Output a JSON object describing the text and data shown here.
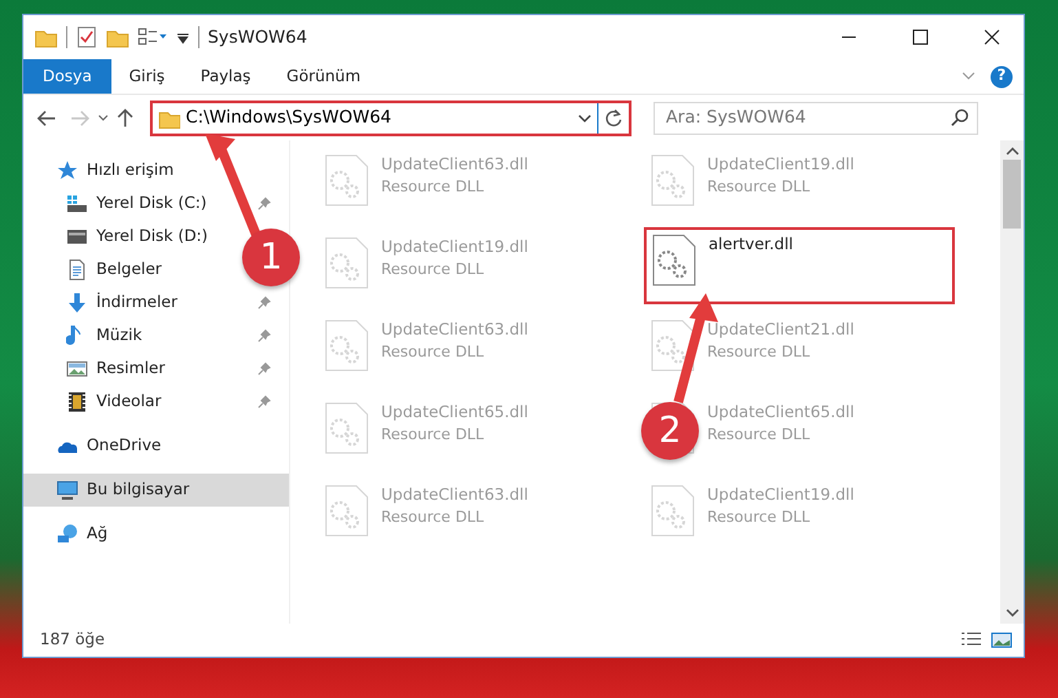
{
  "window": {
    "title": "SysWOW64"
  },
  "ribbon_tabs": [
    {
      "label": "Dosya",
      "selected": true
    },
    {
      "label": "Giriş",
      "selected": false
    },
    {
      "label": "Paylaş",
      "selected": false
    },
    {
      "label": "Görünüm",
      "selected": false
    }
  ],
  "help": "?",
  "navigation": {
    "back_disabled": false,
    "forward_disabled": true
  },
  "address_bar": {
    "path": "C:\\Windows\\SysWOW64",
    "highlighted": true
  },
  "search": {
    "placeholder": "Ara: SysWOW64"
  },
  "sidebar": {
    "items": [
      {
        "label": "Hızlı erişim",
        "kind": "star",
        "selected": false,
        "children": [
          {
            "label": "Yerel Disk (C:)",
            "kind": "drive-c",
            "pinned": true,
            "selected": false
          },
          {
            "label": "Yerel Disk (D:)",
            "kind": "drive",
            "pinned": false,
            "selected": false
          },
          {
            "label": "Belgeler",
            "kind": "document",
            "pinned": false,
            "selected": false
          },
          {
            "label": "İndirmeler",
            "kind": "download",
            "pinned": true,
            "selected": false
          },
          {
            "label": "Müzik",
            "kind": "music",
            "pinned": true,
            "selected": false
          },
          {
            "label": "Resimler",
            "kind": "picture",
            "pinned": true,
            "selected": false
          },
          {
            "label": "Videolar",
            "kind": "video",
            "pinned": true,
            "selected": false
          }
        ]
      },
      {
        "label": "OneDrive",
        "kind": "cloud",
        "selected": false
      },
      {
        "label": "Bu bilgisayar",
        "kind": "computer",
        "selected": true
      },
      {
        "label": "Ağ",
        "kind": "network",
        "selected": false
      }
    ]
  },
  "files": [
    {
      "name": "UpdateClient63.dll",
      "type": "Resource DLL",
      "faded": true,
      "highlighted": false
    },
    {
      "name": "UpdateClient19.dll",
      "type": "Resource DLL",
      "faded": true,
      "highlighted": false
    },
    {
      "name": "UpdateClient19.dll",
      "type": "Resource DLL",
      "faded": true,
      "highlighted": false
    },
    {
      "name": "alertver.dll",
      "faded": false,
      "highlighted": true
    },
    {
      "name": "UpdateClient63.dll",
      "type": "Resource DLL",
      "faded": true,
      "highlighted": false
    },
    {
      "name": "UpdateClient21.dll",
      "type": "Resource DLL",
      "faded": true,
      "highlighted": false
    },
    {
      "name": "UpdateClient65.dll",
      "type": "Resource DLL",
      "faded": true,
      "highlighted": false
    },
    {
      "name": "UpdateClient65.dll",
      "type": "Resource DLL",
      "faded": true,
      "highlighted": false
    },
    {
      "name": "UpdateClient63.dll",
      "type": "Resource DLL",
      "faded": true,
      "highlighted": false
    },
    {
      "name": "UpdateClient19.dll",
      "type": "Resource DLL",
      "faded": true,
      "highlighted": false
    }
  ],
  "status_bar": {
    "count": "187 öğe"
  },
  "annotations": [
    {
      "label": "1"
    },
    {
      "label": "2"
    }
  ]
}
